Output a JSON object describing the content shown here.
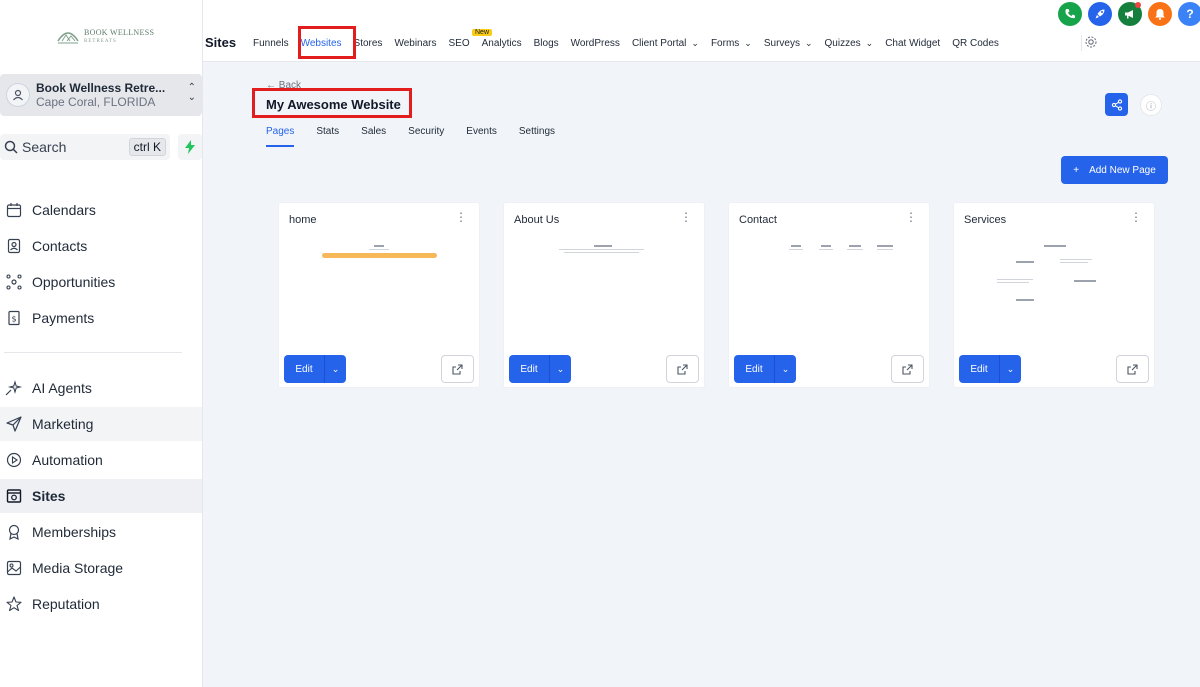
{
  "brand": {
    "line1": "BOOK WELLNESS",
    "line2": "RETREATS"
  },
  "account": {
    "name": "Book Wellness Retre...",
    "location": "Cape Coral, FLORIDA"
  },
  "search": {
    "label": "Search",
    "shortcut": "ctrl K"
  },
  "sidebar": {
    "items": [
      {
        "label": "Calendars",
        "icon": "calendar-icon"
      },
      {
        "label": "Contacts",
        "icon": "contacts-icon"
      },
      {
        "label": "Opportunities",
        "icon": "opportunities-icon"
      },
      {
        "label": "Payments",
        "icon": "payments-icon"
      },
      {
        "label": "AI Agents",
        "icon": "ai-agents-icon"
      },
      {
        "label": "Marketing",
        "icon": "send-icon"
      },
      {
        "label": "Automation",
        "icon": "automation-icon"
      },
      {
        "label": "Sites",
        "icon": "sites-icon"
      },
      {
        "label": "Memberships",
        "icon": "membership-icon"
      },
      {
        "label": "Media Storage",
        "icon": "image-icon"
      },
      {
        "label": "Reputation",
        "icon": "star-icon"
      }
    ]
  },
  "topnav": {
    "section": "Sites",
    "new_badge": "New",
    "links": [
      {
        "label": "Funnels"
      },
      {
        "label": "Websites"
      },
      {
        "label": "Stores"
      },
      {
        "label": "Webinars"
      },
      {
        "label": "SEO"
      },
      {
        "label": "Analytics"
      },
      {
        "label": "Blogs"
      },
      {
        "label": "WordPress"
      },
      {
        "label": "Client Portal"
      },
      {
        "label": "Forms"
      },
      {
        "label": "Surveys"
      },
      {
        "label": "Quizzes"
      },
      {
        "label": "Chat Widget"
      },
      {
        "label": "QR Codes"
      }
    ]
  },
  "main": {
    "back": "← Back",
    "title": "My Awesome Website",
    "tabs": [
      "Pages",
      "Stats",
      "Sales",
      "Security",
      "Events",
      "Settings"
    ],
    "add_page": "Add New Page",
    "edit_label": "Edit",
    "pages": [
      {
        "name": "home"
      },
      {
        "name": "About Us"
      },
      {
        "name": "Contact"
      },
      {
        "name": "Services"
      }
    ]
  },
  "colors": {
    "accent": "#2563eb",
    "highlight": "#e11d1d",
    "badge": "#facc15"
  }
}
